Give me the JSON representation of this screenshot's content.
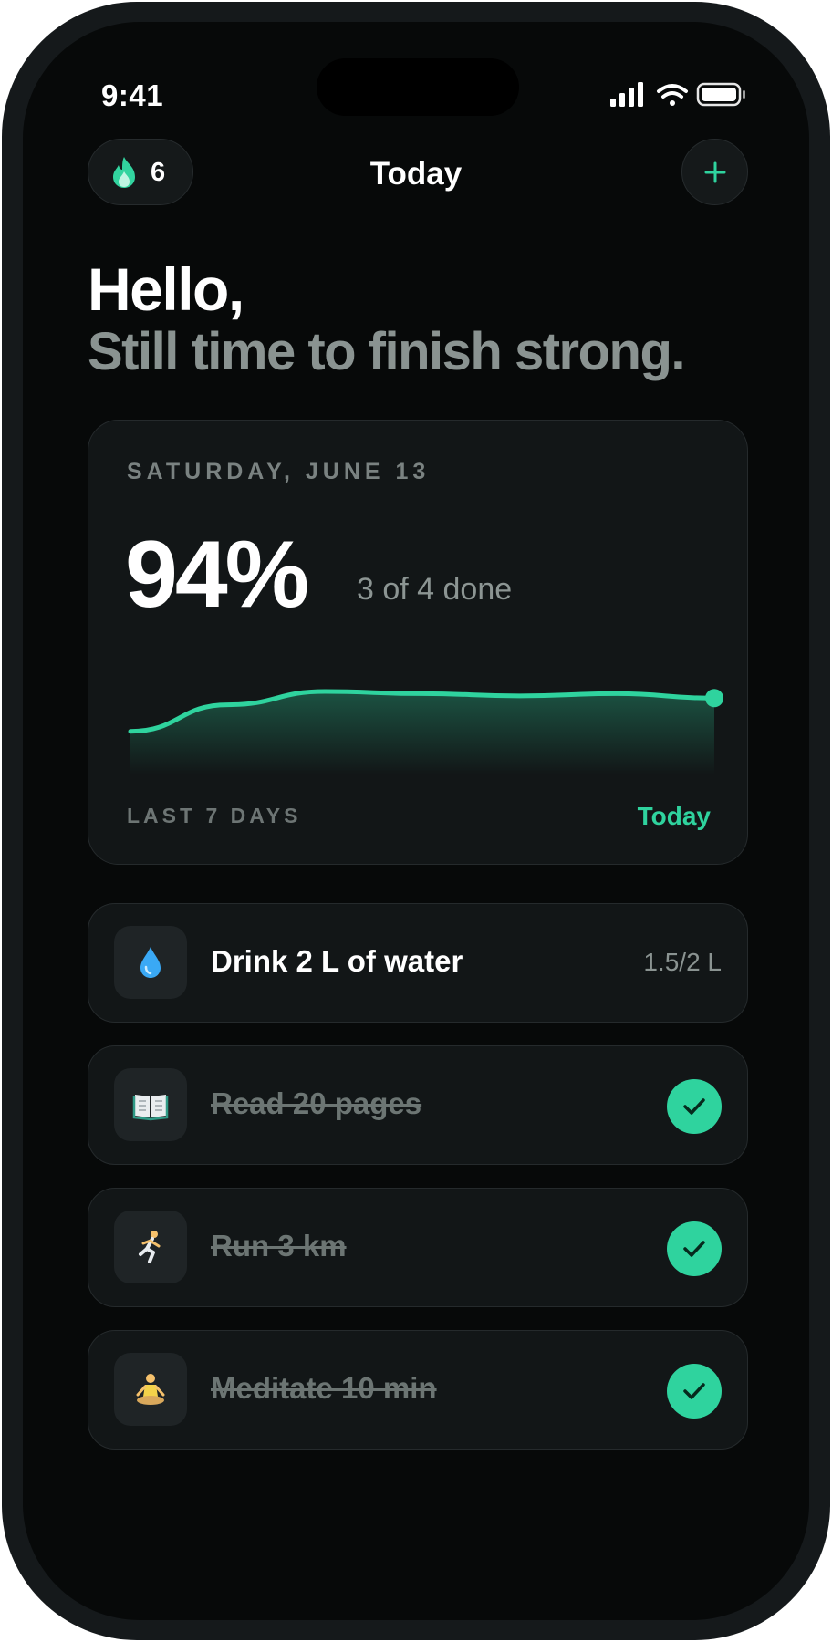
{
  "status_bar": {
    "time": "9:41"
  },
  "header": {
    "streak_count": "6",
    "title": "Today",
    "add_icon": "plus-icon",
    "streak_icon": "flame-icon"
  },
  "greeting": {
    "line1": "Hello,",
    "line2": "Still time to finish strong."
  },
  "summary": {
    "date": "SATURDAY, JUNE 13",
    "percent": "94%",
    "done_text": "3 of 4 done",
    "range_label": "LAST 7 DAYS",
    "end_label": "Today"
  },
  "chart_data": {
    "type": "area",
    "points": 7,
    "values": [
      0.7,
      0.82,
      0.88,
      0.87,
      0.86,
      0.87,
      0.85
    ],
    "accent": "#2fd39e",
    "grid": false
  },
  "habits": [
    {
      "label": "Drink 2 L of water",
      "progress": "1.5/2 L",
      "done": false,
      "icon": "water-drop-icon"
    },
    {
      "label": "Read 20 pages",
      "progress": "",
      "done": true,
      "icon": "book-icon"
    },
    {
      "label": "Run 3 km",
      "progress": "",
      "done": true,
      "icon": "runner-icon"
    },
    {
      "label": "Meditate 10 min",
      "progress": "",
      "done": true,
      "icon": "meditation-icon"
    }
  ],
  "colors": {
    "accent": "#2fd39e",
    "background": "#070909",
    "card": "#121617",
    "muted_text": "#8a9391"
  }
}
